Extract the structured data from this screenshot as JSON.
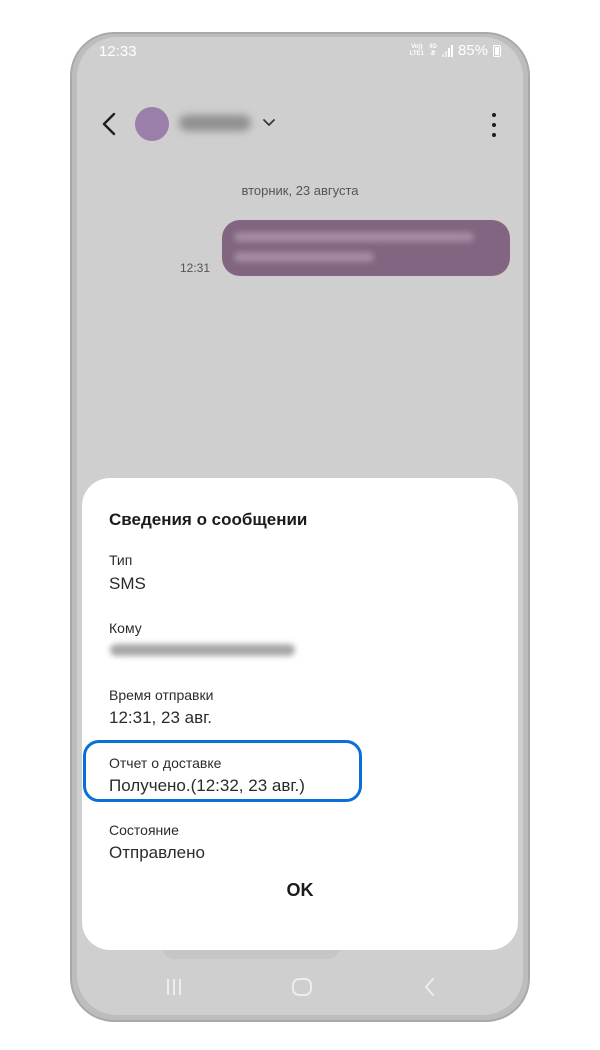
{
  "status_bar": {
    "time": "12:33",
    "volte": "Vo))",
    "lte": "LTE1",
    "network": "4G",
    "battery": "85%"
  },
  "conversation": {
    "date_divider": "вторник, 23 августа",
    "message_time": "12:31"
  },
  "dialog": {
    "title": "Сведения о сообщении",
    "type_label": "Тип",
    "type_value": "SMS",
    "to_label": "Кому",
    "sent_time_label": "Время отправки",
    "sent_time_value": "12:31, 23 авг.",
    "delivery_label": "Отчет о доставке",
    "delivery_value": "Получено.(12:32, 23 авг.)",
    "status_label": "Состояние",
    "status_value": "Отправлено",
    "ok_label": "OK"
  },
  "colors": {
    "highlight": "#0a6fd6",
    "bubble": "#826580",
    "avatar": "#9a7fa9"
  }
}
